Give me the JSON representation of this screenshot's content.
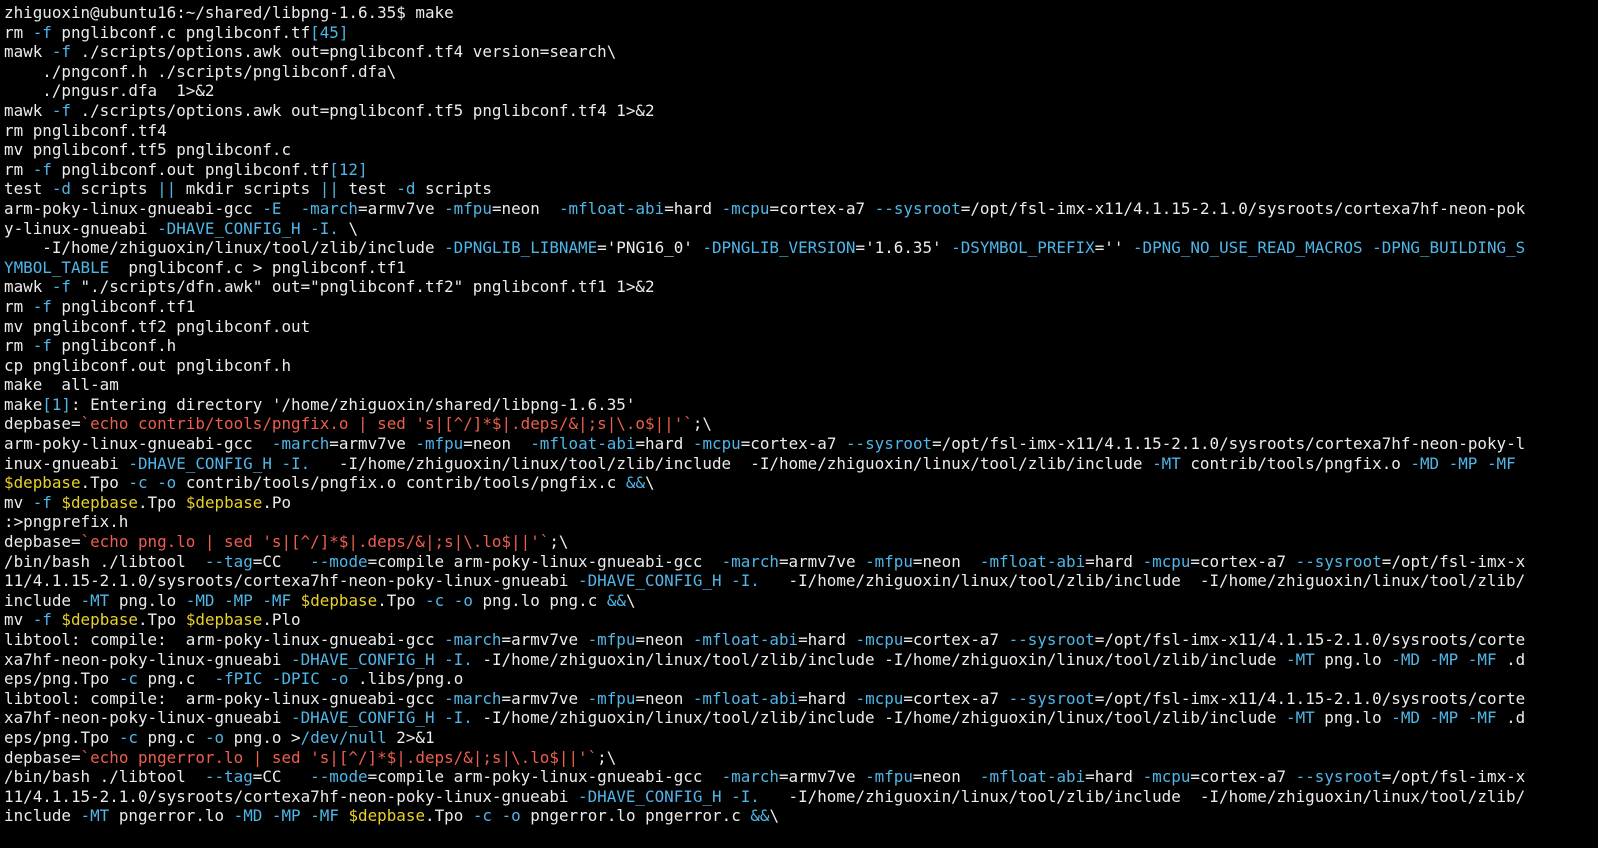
{
  "colors": {
    "background": "#000000",
    "text": "#ececec",
    "flag": "#4fb6e8",
    "string": "#ee5e4e",
    "var": "#e8d12a"
  },
  "terminal": {
    "lines": [
      [
        [
          "t",
          "zhiguoxin@ubuntu16:~/shared/libpng-1.6.35$ make"
        ]
      ],
      [
        [
          "t",
          "rm "
        ],
        [
          "f",
          "-f"
        ],
        [
          "t",
          " pnglibconf.c pnglibconf.tf"
        ],
        [
          "f",
          "[45]"
        ]
      ],
      [
        [
          "t",
          "mawk "
        ],
        [
          "f",
          "-f"
        ],
        [
          "t",
          " ./scripts/options.awk out=pnglibconf.tf4 version=search\\"
        ]
      ],
      [
        [
          "t",
          "    ./pngconf.h ./scripts/pnglibconf.dfa\\"
        ]
      ],
      [
        [
          "t",
          "    ./pngusr.dfa  1>&2"
        ]
      ],
      [
        [
          "t",
          "mawk "
        ],
        [
          "f",
          "-f"
        ],
        [
          "t",
          " ./scripts/options.awk out=pnglibconf.tf5 pnglibconf.tf4 1>&2"
        ]
      ],
      [
        [
          "t",
          "rm pnglibconf.tf4"
        ]
      ],
      [
        [
          "t",
          "mv pnglibconf.tf5 pnglibconf.c"
        ]
      ],
      [
        [
          "t",
          "rm "
        ],
        [
          "f",
          "-f"
        ],
        [
          "t",
          " pnglibconf.out pnglibconf.tf"
        ],
        [
          "f",
          "[12]"
        ]
      ],
      [
        [
          "t",
          "test "
        ],
        [
          "f",
          "-d"
        ],
        [
          "t",
          " scripts "
        ],
        [
          "f",
          "||"
        ],
        [
          "t",
          " mkdir scripts "
        ],
        [
          "f",
          "||"
        ],
        [
          "t",
          " test "
        ],
        [
          "f",
          "-d"
        ],
        [
          "t",
          " scripts"
        ]
      ],
      [
        [
          "t",
          "arm-poky-linux-gnueabi-gcc "
        ],
        [
          "f",
          "-E"
        ],
        [
          "t",
          "  "
        ],
        [
          "f",
          "-march"
        ],
        [
          "t",
          "=armv7ve "
        ],
        [
          "f",
          "-mfpu"
        ],
        [
          "t",
          "=neon  "
        ],
        [
          "f",
          "-mfloat-abi"
        ],
        [
          "t",
          "=hard "
        ],
        [
          "f",
          "-mcpu"
        ],
        [
          "t",
          "=cortex-a7 "
        ],
        [
          "f",
          "--sysroot"
        ],
        [
          "t",
          "=/opt/fsl-imx-x11/4.1.15-2.1.0/sysroots/cortexa7hf-neon-pok"
        ]
      ],
      [
        [
          "t",
          "y-linux-gnueabi "
        ],
        [
          "f",
          "-DHAVE_CONFIG_H"
        ],
        [
          "t",
          " "
        ],
        [
          "f",
          "-I."
        ],
        [
          "t",
          " \\"
        ]
      ],
      [
        [
          "t",
          "    -I/home/zhiguoxin/linux/tool/zlib/include "
        ],
        [
          "f",
          "-DPNGLIB_LIBNAME"
        ],
        [
          "t",
          "='PNG16_0' "
        ],
        [
          "f",
          "-DPNGLIB_VERSION"
        ],
        [
          "t",
          "='1.6.35' "
        ],
        [
          "f",
          "-DSYMBOL_PREFIX"
        ],
        [
          "t",
          "='' "
        ],
        [
          "f",
          "-DPNG_NO_USE_READ_MACROS"
        ],
        [
          "t",
          " "
        ],
        [
          "f",
          "-DPNG_BUILDING_S"
        ]
      ],
      [
        [
          "f",
          "YMBOL_TABLE"
        ],
        [
          "t",
          "  pnglibconf.c > pnglibconf.tf1"
        ]
      ],
      [
        [
          "t",
          "mawk "
        ],
        [
          "f",
          "-f"
        ],
        [
          "t",
          " \"./scripts/dfn.awk\" out=\"pnglibconf.tf2\" pnglibconf.tf1 1>&2"
        ]
      ],
      [
        [
          "t",
          "rm "
        ],
        [
          "f",
          "-f"
        ],
        [
          "t",
          " pnglibconf.tf1"
        ]
      ],
      [
        [
          "t",
          "mv pnglibconf.tf2 pnglibconf.out"
        ]
      ],
      [
        [
          "t",
          "rm "
        ],
        [
          "f",
          "-f"
        ],
        [
          "t",
          " pnglibconf.h"
        ]
      ],
      [
        [
          "t",
          "cp pnglibconf.out pnglibconf.h"
        ]
      ],
      [
        [
          "t",
          "make  all-am"
        ]
      ],
      [
        [
          "t",
          "make"
        ],
        [
          "f",
          "[1]"
        ],
        [
          "t",
          ": Entering directory '/home/zhiguoxin/shared/libpng-1.6.35'"
        ]
      ],
      [
        [
          "t",
          "depbase="
        ],
        [
          "s",
          "`echo contrib/tools/pngfix.o | sed 's|[^/]*$|.deps/&|;s|\\.o$||'`"
        ],
        [
          "t",
          ";\\"
        ]
      ],
      [
        [
          "t",
          "arm-poky-linux-gnueabi-gcc  "
        ],
        [
          "f",
          "-march"
        ],
        [
          "t",
          "=armv7ve "
        ],
        [
          "f",
          "-mfpu"
        ],
        [
          "t",
          "=neon  "
        ],
        [
          "f",
          "-mfloat-abi"
        ],
        [
          "t",
          "=hard "
        ],
        [
          "f",
          "-mcpu"
        ],
        [
          "t",
          "=cortex-a7 "
        ],
        [
          "f",
          "--sysroot"
        ],
        [
          "t",
          "=/opt/fsl-imx-x11/4.1.15-2.1.0/sysroots/cortexa7hf-neon-poky-l"
        ]
      ],
      [
        [
          "t",
          "inux-gnueabi "
        ],
        [
          "f",
          "-DHAVE_CONFIG_H"
        ],
        [
          "t",
          " "
        ],
        [
          "f",
          "-I."
        ],
        [
          "t",
          "   -I/home/zhiguoxin/linux/tool/zlib/include  -I/home/zhiguoxin/linux/tool/zlib/include "
        ],
        [
          "f",
          "-MT"
        ],
        [
          "t",
          " contrib/tools/pngfix.o "
        ],
        [
          "f",
          "-MD"
        ],
        [
          "t",
          " "
        ],
        [
          "f",
          "-MP"
        ],
        [
          "t",
          " "
        ],
        [
          "f",
          "-MF"
        ]
      ],
      [
        [
          "v",
          "$depbase"
        ],
        [
          "t",
          ".Tpo "
        ],
        [
          "f",
          "-c"
        ],
        [
          "t",
          " "
        ],
        [
          "f",
          "-o"
        ],
        [
          "t",
          " contrib/tools/pngfix.o contrib/tools/pngfix.c "
        ],
        [
          "f",
          "&&"
        ],
        [
          "t",
          "\\"
        ]
      ],
      [
        [
          "t",
          "mv "
        ],
        [
          "f",
          "-f"
        ],
        [
          "t",
          " "
        ],
        [
          "v",
          "$depbase"
        ],
        [
          "t",
          ".Tpo "
        ],
        [
          "v",
          "$depbase"
        ],
        [
          "t",
          ".Po"
        ]
      ],
      [
        [
          "t",
          ":>pngprefix.h"
        ]
      ],
      [
        [
          "t",
          "depbase="
        ],
        [
          "s",
          "`echo png.lo | sed 's|[^/]*$|.deps/&|;s|\\.lo$||'`"
        ],
        [
          "t",
          ";\\"
        ]
      ],
      [
        [
          "t",
          "/bin/bash ./libtool  "
        ],
        [
          "f",
          "--tag"
        ],
        [
          "t",
          "=CC   "
        ],
        [
          "f",
          "--mode"
        ],
        [
          "t",
          "=compile arm-poky-linux-gnueabi-gcc  "
        ],
        [
          "f",
          "-march"
        ],
        [
          "t",
          "=armv7ve "
        ],
        [
          "f",
          "-mfpu"
        ],
        [
          "t",
          "=neon  "
        ],
        [
          "f",
          "-mfloat-abi"
        ],
        [
          "t",
          "=hard "
        ],
        [
          "f",
          "-mcpu"
        ],
        [
          "t",
          "=cortex-a7 "
        ],
        [
          "f",
          "--sysroot"
        ],
        [
          "t",
          "=/opt/fsl-imx-x"
        ]
      ],
      [
        [
          "t",
          "11/4.1.15-2.1.0/sysroots/cortexa7hf-neon-poky-linux-gnueabi "
        ],
        [
          "f",
          "-DHAVE_CONFIG_H"
        ],
        [
          "t",
          " "
        ],
        [
          "f",
          "-I."
        ],
        [
          "t",
          "   -I/home/zhiguoxin/linux/tool/zlib/include  -I/home/zhiguoxin/linux/tool/zlib/"
        ]
      ],
      [
        [
          "t",
          "include "
        ],
        [
          "f",
          "-MT"
        ],
        [
          "t",
          " png.lo "
        ],
        [
          "f",
          "-MD"
        ],
        [
          "t",
          " "
        ],
        [
          "f",
          "-MP"
        ],
        [
          "t",
          " "
        ],
        [
          "f",
          "-MF"
        ],
        [
          "t",
          " "
        ],
        [
          "v",
          "$depbase"
        ],
        [
          "t",
          ".Tpo "
        ],
        [
          "f",
          "-c"
        ],
        [
          "t",
          " "
        ],
        [
          "f",
          "-o"
        ],
        [
          "t",
          " png.lo png.c "
        ],
        [
          "f",
          "&&"
        ],
        [
          "t",
          "\\"
        ]
      ],
      [
        [
          "t",
          "mv "
        ],
        [
          "f",
          "-f"
        ],
        [
          "t",
          " "
        ],
        [
          "v",
          "$depbase"
        ],
        [
          "t",
          ".Tpo "
        ],
        [
          "v",
          "$depbase"
        ],
        [
          "t",
          ".Plo"
        ]
      ],
      [
        [
          "t",
          "libtool: compile:  arm-poky-linux-gnueabi-gcc "
        ],
        [
          "f",
          "-march"
        ],
        [
          "t",
          "=armv7ve "
        ],
        [
          "f",
          "-mfpu"
        ],
        [
          "t",
          "=neon "
        ],
        [
          "f",
          "-mfloat-abi"
        ],
        [
          "t",
          "=hard "
        ],
        [
          "f",
          "-mcpu"
        ],
        [
          "t",
          "=cortex-a7 "
        ],
        [
          "f",
          "--sysroot"
        ],
        [
          "t",
          "=/opt/fsl-imx-x11/4.1.15-2.1.0/sysroots/corte"
        ]
      ],
      [
        [
          "t",
          "xa7hf-neon-poky-linux-gnueabi "
        ],
        [
          "f",
          "-DHAVE_CONFIG_H"
        ],
        [
          "t",
          " "
        ],
        [
          "f",
          "-I."
        ],
        [
          "t",
          " -I/home/zhiguoxin/linux/tool/zlib/include -I/home/zhiguoxin/linux/tool/zlib/include "
        ],
        [
          "f",
          "-MT"
        ],
        [
          "t",
          " png.lo "
        ],
        [
          "f",
          "-MD"
        ],
        [
          "t",
          " "
        ],
        [
          "f",
          "-MP"
        ],
        [
          "t",
          " "
        ],
        [
          "f",
          "-MF"
        ],
        [
          "t",
          " .d"
        ]
      ],
      [
        [
          "t",
          "eps/png.Tpo "
        ],
        [
          "f",
          "-c"
        ],
        [
          "t",
          " png.c  "
        ],
        [
          "f",
          "-fPIC"
        ],
        [
          "t",
          " "
        ],
        [
          "f",
          "-DPIC"
        ],
        [
          "t",
          " "
        ],
        [
          "f",
          "-o"
        ],
        [
          "t",
          " .libs/png.o"
        ]
      ],
      [
        [
          "t",
          "libtool: compile:  arm-poky-linux-gnueabi-gcc "
        ],
        [
          "f",
          "-march"
        ],
        [
          "t",
          "=armv7ve "
        ],
        [
          "f",
          "-mfpu"
        ],
        [
          "t",
          "=neon "
        ],
        [
          "f",
          "-mfloat-abi"
        ],
        [
          "t",
          "=hard "
        ],
        [
          "f",
          "-mcpu"
        ],
        [
          "t",
          "=cortex-a7 "
        ],
        [
          "f",
          "--sysroot"
        ],
        [
          "t",
          "=/opt/fsl-imx-x11/4.1.15-2.1.0/sysroots/corte"
        ]
      ],
      [
        [
          "t",
          "xa7hf-neon-poky-linux-gnueabi "
        ],
        [
          "f",
          "-DHAVE_CONFIG_H"
        ],
        [
          "t",
          " "
        ],
        [
          "f",
          "-I."
        ],
        [
          "t",
          " -I/home/zhiguoxin/linux/tool/zlib/include -I/home/zhiguoxin/linux/tool/zlib/include "
        ],
        [
          "f",
          "-MT"
        ],
        [
          "t",
          " png.lo "
        ],
        [
          "f",
          "-MD"
        ],
        [
          "t",
          " "
        ],
        [
          "f",
          "-MP"
        ],
        [
          "t",
          " "
        ],
        [
          "f",
          "-MF"
        ],
        [
          "t",
          " .d"
        ]
      ],
      [
        [
          "t",
          "eps/png.Tpo "
        ],
        [
          "f",
          "-c"
        ],
        [
          "t",
          " png.c "
        ],
        [
          "f",
          "-o"
        ],
        [
          "t",
          " png.o >"
        ],
        [
          "f",
          "/dev/null"
        ],
        [
          "t",
          " 2>&1"
        ]
      ],
      [
        [
          "t",
          "depbase="
        ],
        [
          "s",
          "`echo pngerror.lo | sed 's|[^/]*$|.deps/&|;s|\\.lo$||'`"
        ],
        [
          "t",
          ";\\"
        ]
      ],
      [
        [
          "t",
          "/bin/bash ./libtool  "
        ],
        [
          "f",
          "--tag"
        ],
        [
          "t",
          "=CC   "
        ],
        [
          "f",
          "--mode"
        ],
        [
          "t",
          "=compile arm-poky-linux-gnueabi-gcc  "
        ],
        [
          "f",
          "-march"
        ],
        [
          "t",
          "=armv7ve "
        ],
        [
          "f",
          "-mfpu"
        ],
        [
          "t",
          "=neon  "
        ],
        [
          "f",
          "-mfloat-abi"
        ],
        [
          "t",
          "=hard "
        ],
        [
          "f",
          "-mcpu"
        ],
        [
          "t",
          "=cortex-a7 "
        ],
        [
          "f",
          "--sysroot"
        ],
        [
          "t",
          "=/opt/fsl-imx-x"
        ]
      ],
      [
        [
          "t",
          "11/4.1.15-2.1.0/sysroots/cortexa7hf-neon-poky-linux-gnueabi "
        ],
        [
          "f",
          "-DHAVE_CONFIG_H"
        ],
        [
          "t",
          " "
        ],
        [
          "f",
          "-I."
        ],
        [
          "t",
          "   -I/home/zhiguoxin/linux/tool/zlib/include  -I/home/zhiguoxin/linux/tool/zlib/"
        ]
      ],
      [
        [
          "t",
          "include "
        ],
        [
          "f",
          "-MT"
        ],
        [
          "t",
          " pngerror.lo "
        ],
        [
          "f",
          "-MD"
        ],
        [
          "t",
          " "
        ],
        [
          "f",
          "-MP"
        ],
        [
          "t",
          " "
        ],
        [
          "f",
          "-MF"
        ],
        [
          "t",
          " "
        ],
        [
          "v",
          "$depbase"
        ],
        [
          "t",
          ".Tpo "
        ],
        [
          "f",
          "-c"
        ],
        [
          "t",
          " "
        ],
        [
          "f",
          "-o"
        ],
        [
          "t",
          " pngerror.lo pngerror.c "
        ],
        [
          "f",
          "&&"
        ],
        [
          "t",
          "\\"
        ]
      ]
    ]
  }
}
